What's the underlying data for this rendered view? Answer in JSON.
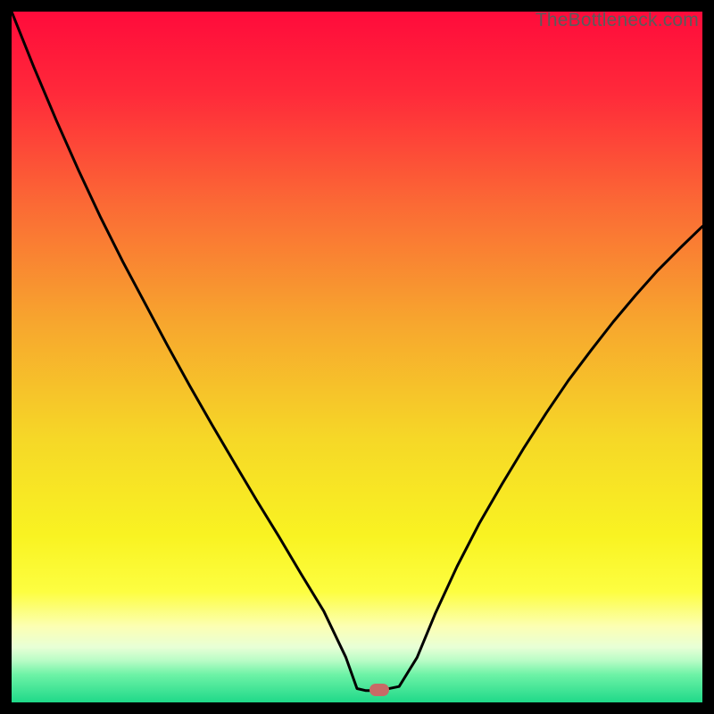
{
  "watermark": "TheBottleneck.com",
  "marker": {
    "color": "#c86a66",
    "left_pct": 53.2,
    "top_pct": 98.2
  },
  "chart_data": {
    "type": "line",
    "title": "",
    "xlabel": "",
    "ylabel": "",
    "xlim": [
      0,
      100
    ],
    "ylim": [
      0,
      100
    ],
    "gradient_stops": [
      {
        "offset": 0,
        "color": "#ff0b3b"
      },
      {
        "offset": 12,
        "color": "#ff2a3a"
      },
      {
        "offset": 28,
        "color": "#fb6a35"
      },
      {
        "offset": 45,
        "color": "#f7a62e"
      },
      {
        "offset": 62,
        "color": "#f6d827"
      },
      {
        "offset": 76,
        "color": "#f9f322"
      },
      {
        "offset": 84,
        "color": "#fdfe41"
      },
      {
        "offset": 89,
        "color": "#fcffb3"
      },
      {
        "offset": 92,
        "color": "#e8ffd6"
      },
      {
        "offset": 94,
        "color": "#b7fcc5"
      },
      {
        "offset": 96,
        "color": "#6df2a6"
      },
      {
        "offset": 100,
        "color": "#1fd989"
      }
    ],
    "series": [
      {
        "name": "bottleneck-curve",
        "x": [
          0.0,
          3.2,
          6.5,
          9.7,
          12.9,
          16.1,
          19.4,
          22.6,
          25.8,
          29.0,
          32.3,
          35.5,
          38.7,
          41.9,
          45.2,
          48.4,
          50.0,
          51.3,
          53.2,
          56.1,
          58.7,
          61.3,
          64.5,
          67.7,
          71.0,
          74.2,
          77.4,
          80.6,
          83.9,
          87.1,
          90.3,
          93.5,
          96.8,
          100.0
        ],
        "y": [
          100.0,
          92.0,
          84.2,
          77.0,
          70.2,
          63.8,
          57.6,
          51.6,
          45.8,
          40.2,
          34.6,
          29.2,
          24.0,
          18.6,
          13.2,
          6.5,
          2.0,
          1.7,
          1.7,
          2.3,
          6.5,
          12.8,
          19.7,
          25.9,
          31.6,
          36.9,
          41.9,
          46.6,
          51.0,
          55.1,
          58.9,
          62.5,
          65.8,
          68.9
        ]
      }
    ],
    "marker_point": {
      "x": 53.2,
      "y": 1.8
    }
  }
}
